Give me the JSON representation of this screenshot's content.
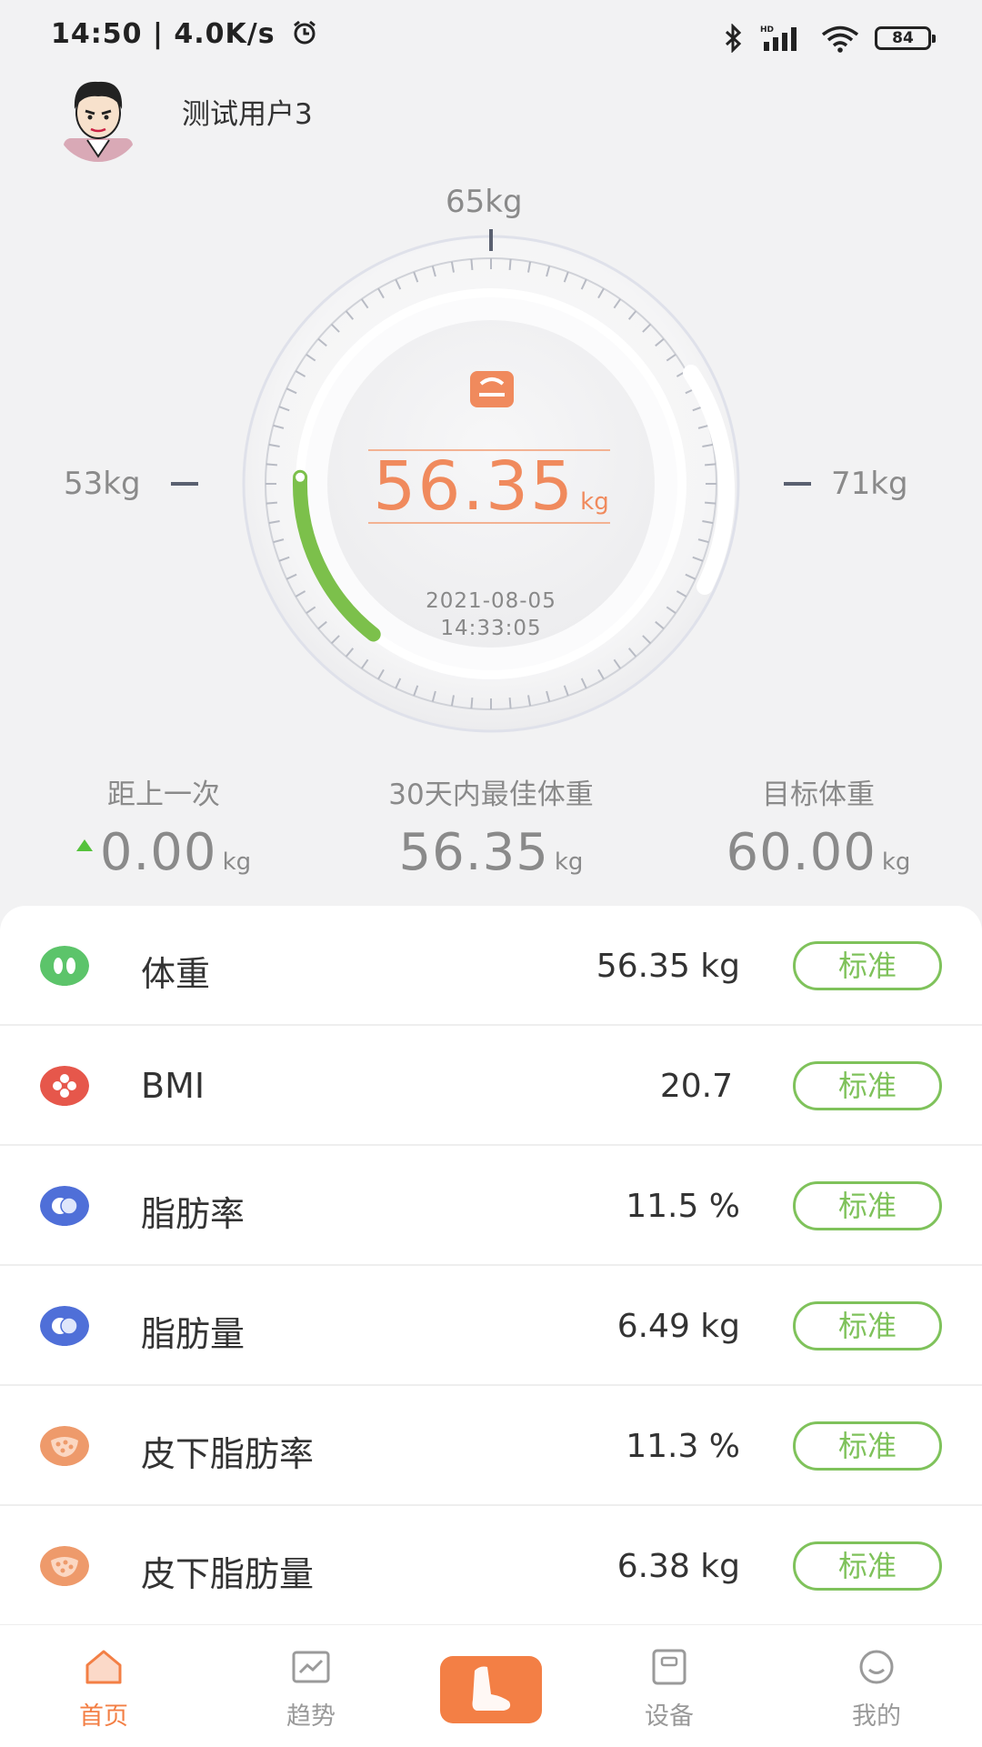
{
  "status_bar": {
    "time": "14:50",
    "speed": "4.0K/s",
    "battery": "84",
    "icons": [
      "alarm-icon",
      "bluetooth-icon",
      "signal-icon",
      "wifi-icon",
      "battery-icon"
    ]
  },
  "user": {
    "name": "测试用户3"
  },
  "gauge": {
    "top_label": "65kg",
    "left_label": "53kg",
    "right_label": "71kg",
    "weight": "56.35",
    "unit": "kg",
    "date": "2021-08-05",
    "time": "14:33:05",
    "range_min_kg": 53,
    "range_max_kg": 71,
    "accent_color": "#f08a5d",
    "arc_color": "#7cc04b"
  },
  "stats": [
    {
      "label": "距上一次",
      "value": "0.00",
      "unit": "kg",
      "trend": "up"
    },
    {
      "label": "30天内最佳体重",
      "value": "56.35",
      "unit": "kg"
    },
    {
      "label": "目标体重",
      "value": "60.00",
      "unit": "kg"
    }
  ],
  "metrics": [
    {
      "name": "体重",
      "value": "56.35 kg",
      "status": "标准",
      "icon": "footprint-icon",
      "color": "#5cc46a"
    },
    {
      "name": "BMI",
      "value": "20.7",
      "status": "标准",
      "icon": "bmi-icon",
      "color": "#e6574b"
    },
    {
      "name": "脂肪率",
      "value": "11.5 %",
      "status": "标准",
      "icon": "fat-rate-icon",
      "color": "#4f6fd8"
    },
    {
      "name": "脂肪量",
      "value": "6.49 kg",
      "status": "标准",
      "icon": "fat-mass-icon",
      "color": "#4f6fd8"
    },
    {
      "name": "皮下脂肪率",
      "value": "11.3 %",
      "status": "标准",
      "icon": "subcutaneous-fat-icon",
      "color": "#ee9a6b"
    },
    {
      "name": "皮下脂肪量",
      "value": "6.38 kg",
      "status": "标准",
      "icon": "subcutaneous-fat-mass-icon",
      "color": "#ee9a6b"
    }
  ],
  "nav": {
    "items": [
      {
        "label": "首页",
        "icon": "home-icon",
        "active": true
      },
      {
        "label": "趋势",
        "icon": "trend-icon"
      },
      {
        "label": "",
        "icon": "foot-scale-icon"
      },
      {
        "label": "设备",
        "icon": "device-icon"
      },
      {
        "label": "我的",
        "icon": "profile-icon"
      }
    ],
    "active_color": "#f37f45"
  }
}
